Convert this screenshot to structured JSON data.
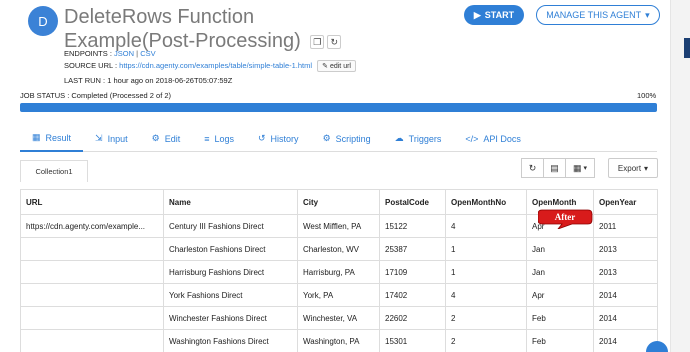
{
  "header": {
    "avatar_letter": "D",
    "title": "DeleteRows Function Example(Post-Processing)",
    "start_label": "START",
    "manage_label": "MANAGE THIS AGENT"
  },
  "meta": {
    "endpoints_label": "ENDPOINTS :",
    "endpoint_json": "JSON",
    "endpoint_sep": "|",
    "endpoint_csv": "CSV",
    "source_label": "SOURCE URL :",
    "source_url": "https://cdn.agenty.com/examples/table/simple-table-1.html",
    "edit_url_label": "edit url",
    "last_run_label": "LAST RUN :",
    "last_run_value": "1 hour ago on 2018-06-26T05:07:59Z"
  },
  "job": {
    "status_text": "JOB STATUS : Completed (Processed 2 of 2)",
    "percent_text": "100%",
    "progress": 1.0,
    "accent": "#2f7fd6"
  },
  "tabs": [
    {
      "label": "Result",
      "icon": "table-icon"
    },
    {
      "label": "Input",
      "icon": "input-icon"
    },
    {
      "label": "Edit",
      "icon": "gears-icon"
    },
    {
      "label": "Logs",
      "icon": "list-icon"
    },
    {
      "label": "History",
      "icon": "history-icon"
    },
    {
      "label": "Scripting",
      "icon": "code-icon"
    },
    {
      "label": "Triggers",
      "icon": "cloud-upload-icon"
    },
    {
      "label": "API Docs",
      "icon": "brackets-icon"
    }
  ],
  "result": {
    "collection_tab": "Collection1",
    "export_label": "Export",
    "columns": [
      "URL",
      "Name",
      "City",
      "PostalCode",
      "OpenMonthNo",
      "OpenMonth",
      "OpenYear"
    ],
    "rows": [
      [
        "https://cdn.agenty.com/example...",
        "Century III Fashions Direct",
        "West Mifflen, PA",
        "15122",
        "4",
        "Apr",
        "2011"
      ],
      [
        "",
        "Charleston Fashions Direct",
        "Charleston, WV",
        "25387",
        "1",
        "Jan",
        "2013"
      ],
      [
        "",
        "Harrisburg Fashions Direct",
        "Harrisburg, PA",
        "17109",
        "1",
        "Jan",
        "2013"
      ],
      [
        "",
        "York Fashions Direct",
        "York, PA",
        "17402",
        "4",
        "Apr",
        "2014"
      ],
      [
        "",
        "Winchester Fashions Direct",
        "Winchester, VA",
        "22602",
        "2",
        "Feb",
        "2014"
      ],
      [
        "",
        "Washington Fashions Direct",
        "Washington, PA",
        "15301",
        "2",
        "Feb",
        "2014"
      ]
    ],
    "callout_text": "After",
    "callout_color": "#d81b1b"
  }
}
